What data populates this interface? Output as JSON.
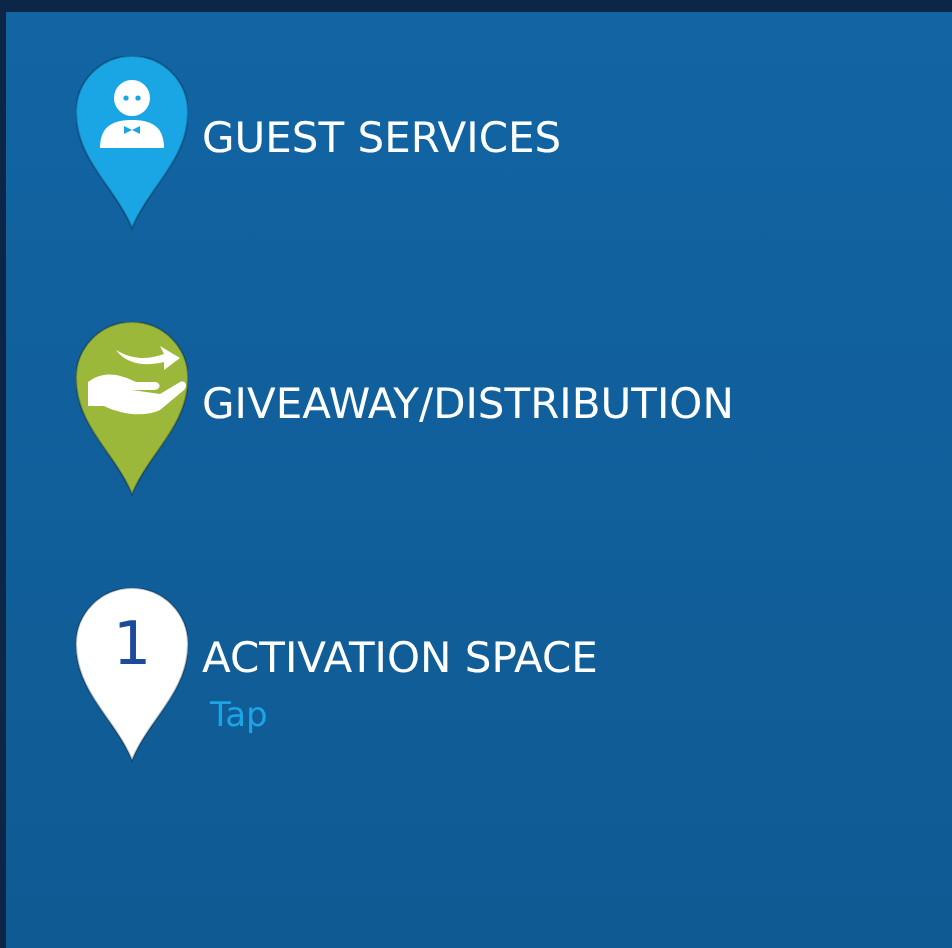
{
  "legend": {
    "items": [
      {
        "kind": "person",
        "color": "#1aa6e4",
        "title": "GUEST SERVICES"
      },
      {
        "kind": "hand",
        "color": "#9cb83a",
        "title": "GIVEAWAY/DISTRIBUTION"
      },
      {
        "kind": "number",
        "color": "#ffffff",
        "number": "1",
        "title": "ACTIVATION SPACE",
        "link": "Tap"
      }
    ]
  }
}
